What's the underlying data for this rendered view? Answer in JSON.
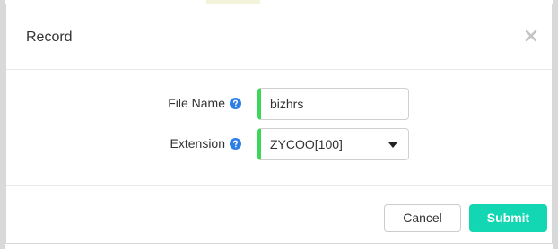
{
  "dialog": {
    "title": "Record",
    "close_icon": "close-icon"
  },
  "form": {
    "file_name": {
      "label": "File Name",
      "help_icon": "question-circle-icon",
      "value": "bizhrs"
    },
    "extension": {
      "label": "Extension",
      "help_icon": "question-circle-icon",
      "selected": "ZYCOO[100]",
      "dropdown_icon": "chevron-down-icon"
    }
  },
  "footer": {
    "cancel_label": "Cancel",
    "submit_label": "Submit"
  },
  "colors": {
    "accent": "#12d7b2",
    "input_marker": "#3dd55b",
    "help_icon": "#2d7ee6"
  }
}
